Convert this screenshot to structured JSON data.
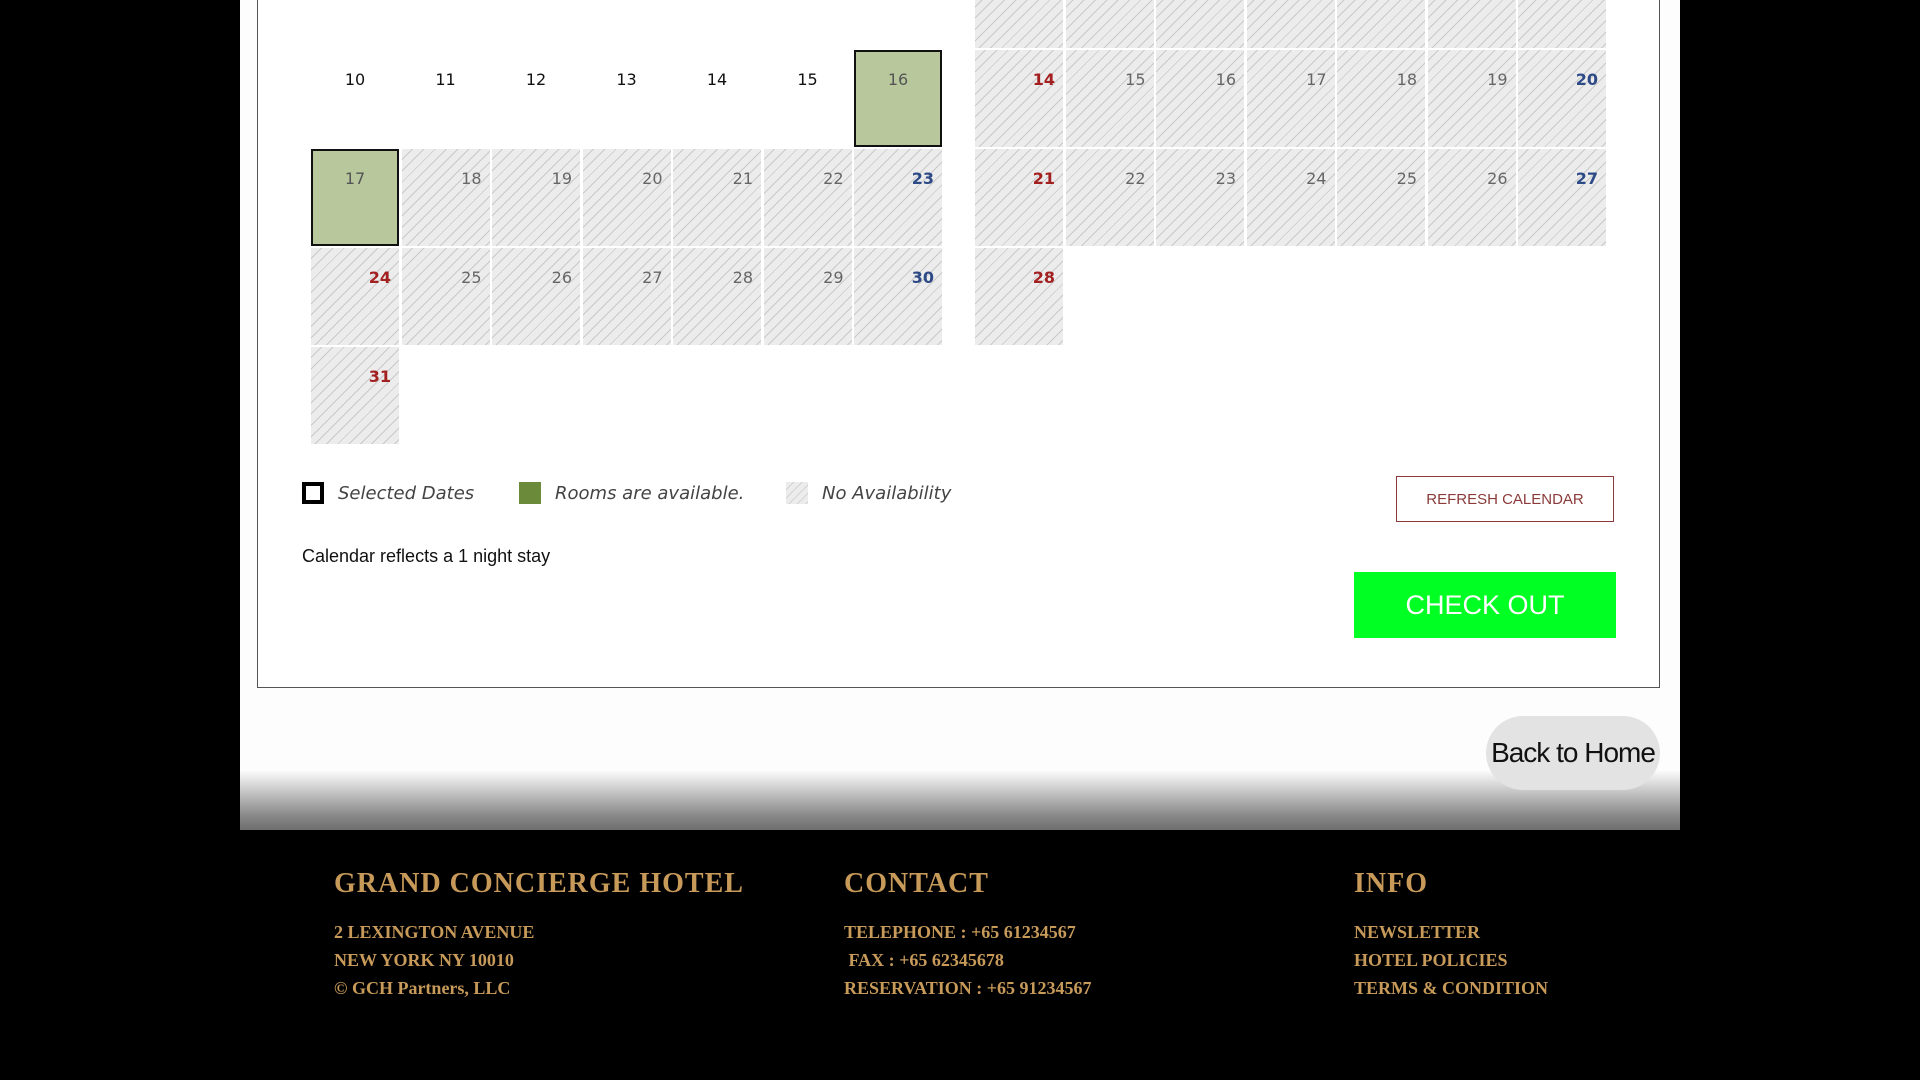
{
  "calendar": {
    "left_month": {
      "weeks": [
        [
          {
            "day": "10",
            "status": "plain"
          },
          {
            "day": "11",
            "status": "plain"
          },
          {
            "day": "12",
            "status": "plain"
          },
          {
            "day": "13",
            "status": "plain"
          },
          {
            "day": "14",
            "status": "plain"
          },
          {
            "day": "15",
            "status": "plain"
          },
          {
            "day": "16",
            "status": "selected"
          }
        ],
        [
          {
            "day": "17",
            "status": "selected"
          },
          {
            "day": "18",
            "status": "none"
          },
          {
            "day": "19",
            "status": "none"
          },
          {
            "day": "20",
            "status": "none"
          },
          {
            "day": "21",
            "status": "none"
          },
          {
            "day": "22",
            "status": "none"
          },
          {
            "day": "23",
            "status": "none",
            "tone": "blue"
          }
        ],
        [
          {
            "day": "24",
            "status": "none",
            "tone": "red"
          },
          {
            "day": "25",
            "status": "none"
          },
          {
            "day": "26",
            "status": "none"
          },
          {
            "day": "27",
            "status": "none"
          },
          {
            "day": "28",
            "status": "none"
          },
          {
            "day": "29",
            "status": "none"
          },
          {
            "day": "30",
            "status": "none",
            "tone": "blue"
          }
        ],
        [
          {
            "day": "31",
            "status": "none",
            "tone": "red"
          }
        ]
      ]
    },
    "right_month": {
      "weeks": [
        [
          {
            "day": "",
            "status": "none"
          },
          {
            "day": "",
            "status": "none"
          },
          {
            "day": "",
            "status": "none"
          },
          {
            "day": "",
            "status": "none"
          },
          {
            "day": "",
            "status": "none"
          },
          {
            "day": "",
            "status": "none"
          },
          {
            "day": "",
            "status": "none"
          }
        ],
        [
          {
            "day": "14",
            "status": "none",
            "tone": "red"
          },
          {
            "day": "15",
            "status": "none"
          },
          {
            "day": "16",
            "status": "none"
          },
          {
            "day": "17",
            "status": "none"
          },
          {
            "day": "18",
            "status": "none"
          },
          {
            "day": "19",
            "status": "none"
          },
          {
            "day": "20",
            "status": "none",
            "tone": "blue"
          }
        ],
        [
          {
            "day": "21",
            "status": "none",
            "tone": "red"
          },
          {
            "day": "22",
            "status": "none"
          },
          {
            "day": "23",
            "status": "none"
          },
          {
            "day": "24",
            "status": "none"
          },
          {
            "day": "25",
            "status": "none"
          },
          {
            "day": "26",
            "status": "none"
          },
          {
            "day": "27",
            "status": "none",
            "tone": "blue"
          }
        ],
        [
          {
            "day": "28",
            "status": "none",
            "tone": "red"
          }
        ]
      ]
    },
    "colors": {
      "selected_fill": "#b8c89c",
      "available_swatch": "#6b8a3a",
      "sunday_red": "#a32020",
      "saturday_blue": "#2d4a86"
    }
  },
  "legend": {
    "selected_label": "Selected Dates",
    "available_label": "Rooms are available.",
    "none_label": "No Availability"
  },
  "stay_note": "Calendar reflects a 1 night stay",
  "buttons": {
    "refresh": "REFRESH CALENDAR",
    "checkout": "CHECK OUT",
    "home": "Back to Home"
  },
  "footer": {
    "hotel": {
      "title": "GRAND CONCIERGE HOTEL",
      "lines": [
        "2 LEXINGTON AVENUE",
        "NEW YORK NY 10010",
        "© GCH Partners, LLC"
      ]
    },
    "contact": {
      "title": "CONTACT",
      "lines": [
        "TELEPHONE : +65 61234567",
        " FAX : +65 62345678",
        "RESERVATION : +65 91234567"
      ]
    },
    "info": {
      "title": "INFO",
      "links": [
        "NEWSLETTER",
        "HOTEL POLICIES",
        "TERMS & CONDITION"
      ]
    },
    "accent": "#c79a5a"
  }
}
